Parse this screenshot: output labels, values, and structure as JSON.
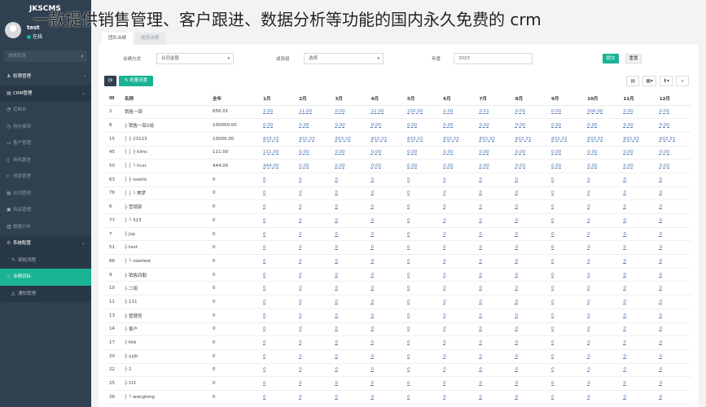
{
  "watermark": "一款提供销售管理、客户跟进、数据分析等功能的国内永久免费的 crm",
  "brand": "JKSCMS",
  "user": {
    "name": "test",
    "status": "在线"
  },
  "sidebar": {
    "search_placeholder": "搜索菜单",
    "items": [
      {
        "label": "权限管理",
        "icon": "users-icon",
        "state": "normal"
      },
      {
        "label": "CRM管理",
        "icon": "grid-icon",
        "state": "open"
      },
      {
        "label": "控制台",
        "icon": "dashboard-icon",
        "state": "dim"
      },
      {
        "label": "待办事项",
        "icon": "clock-icon",
        "state": "dim"
      },
      {
        "label": "客户管理",
        "icon": "folder-icon",
        "state": "dim"
      },
      {
        "label": "商机跟进",
        "icon": "file-icon",
        "state": "dim"
      },
      {
        "label": "线索管理",
        "icon": "search-icon",
        "state": "dim"
      },
      {
        "label": "合同管理",
        "icon": "doc-icon",
        "state": "dim"
      },
      {
        "label": "商品管理",
        "icon": "box-icon",
        "state": "dim"
      },
      {
        "label": "数据分析",
        "icon": "chart-icon",
        "state": "dim"
      },
      {
        "label": "系统配置",
        "icon": "gear-icon",
        "state": "open"
      },
      {
        "label": "审批流程",
        "icon": "flow-icon",
        "state": "sub"
      },
      {
        "label": "业绩目标",
        "icon": "target-icon",
        "state": "active"
      },
      {
        "label": "通知管理",
        "icon": "bell-icon",
        "state": "sub"
      }
    ]
  },
  "tabs": [
    "团队业绩",
    "成员业绩"
  ],
  "filter": {
    "perf_label": "业绩方式",
    "perf_value": "合同金额",
    "member_label": "成员组",
    "member_value": "选择",
    "year_label": "年度",
    "year_value": "2023",
    "submit": "提交",
    "reset": "重置"
  },
  "toolbar": {
    "refresh": "⟳",
    "batch": "✎ 批量设置",
    "btn1": "▤",
    "btn2": "▦▾",
    "btn3": "⬇▾",
    "btn4": "⌕"
  },
  "table": {
    "headers": [
      "ID",
      "名称",
      "全年",
      "1月",
      "2月",
      "3月",
      "4月",
      "5月",
      "6月",
      "7月",
      "8月",
      "9月",
      "10月",
      "11月",
      "12月"
    ],
    "rows": [
      [
        "2",
        "销售一部",
        "656.01",
        "2.00",
        "11.00",
        "0.00",
        "22.00",
        "100.00",
        "0.00",
        "0.01",
        "0.00",
        "0.00",
        "506.00",
        "0.00",
        "0.00"
      ],
      [
        "8",
        "├ 销售一部2组",
        "100000.00",
        "0.00",
        "0.00",
        "0.00",
        "0.00",
        "0.00",
        "0.00",
        "0.00",
        "0.00",
        "0.00",
        "0.00",
        "0.00",
        "0.00"
      ],
      [
        "15",
        "│ ├ 23123",
        "10000.00",
        "833.33",
        "833.33",
        "833.33",
        "833.33",
        "833.33",
        "833.33",
        "833.33",
        "833.33",
        "833.33",
        "833.33",
        "833.33",
        "833.33"
      ],
      [
        "45",
        "│ │ ├ kimc",
        "111.00",
        "111.00",
        "0.00",
        "0.00",
        "0.00",
        "0.00",
        "0.00",
        "0.00",
        "0.00",
        "0.00",
        "0.00",
        "0.00",
        "0.00"
      ],
      [
        "50",
        "│ │ └ hcsi",
        "444.00",
        "444.00",
        "0.00",
        "0.00",
        "0.00",
        "0.00",
        "0.00",
        "0.00",
        "0.00",
        "0.00",
        "0.00",
        "0.00",
        "0.00"
      ],
      [
        "63",
        "│ ├ sswho",
        "0",
        "0",
        "0",
        "0",
        "0",
        "0",
        "0",
        "0",
        "0",
        "0",
        "0",
        "0",
        "0"
      ],
      [
        "76",
        "│ │ └ 美梦",
        "0",
        "0",
        "0",
        "0",
        "0",
        "0",
        "0",
        "0",
        "0",
        "0",
        "0",
        "0",
        "0"
      ],
      [
        "6",
        "├ 营销部",
        "0",
        "0",
        "0",
        "0",
        "0",
        "0",
        "0",
        "0",
        "0",
        "0",
        "0",
        "0",
        "0"
      ],
      [
        "77",
        "│ └ 323",
        "0",
        "0",
        "0",
        "0",
        "0",
        "0",
        "0",
        "0",
        "0",
        "0",
        "0",
        "0",
        "0"
      ],
      [
        "7",
        "├ jsp",
        "0",
        "0",
        "0",
        "0",
        "0",
        "0",
        "0",
        "0",
        "0",
        "0",
        "0",
        "0",
        "0"
      ],
      [
        "51",
        "├ test",
        "0",
        "0",
        "0",
        "0",
        "0",
        "0",
        "0",
        "0",
        "0",
        "0",
        "0",
        "0",
        "0"
      ],
      [
        "86",
        "│ └ xiaotest",
        "0",
        "0",
        "0",
        "0",
        "0",
        "0",
        "0",
        "0",
        "0",
        "0",
        "0",
        "0",
        "0"
      ],
      [
        "9",
        "├ 销售四勤",
        "0",
        "0",
        "0",
        "0",
        "0",
        "0",
        "0",
        "0",
        "0",
        "0",
        "0",
        "0",
        "0"
      ],
      [
        "10",
        "├ 二组",
        "0",
        "0",
        "0",
        "0",
        "0",
        "0",
        "0",
        "0",
        "0",
        "0",
        "0",
        "0",
        "0"
      ],
      [
        "11",
        "├ 111",
        "0",
        "0",
        "0",
        "0",
        "0",
        "0",
        "0",
        "0",
        "0",
        "0",
        "0",
        "0",
        "0"
      ],
      [
        "13",
        "├ 管理员",
        "0",
        "0",
        "0",
        "0",
        "0",
        "0",
        "0",
        "0",
        "0",
        "0",
        "0",
        "0",
        "0"
      ],
      [
        "14",
        "├ 客户",
        "0",
        "0",
        "0",
        "0",
        "0",
        "0",
        "0",
        "0",
        "0",
        "0",
        "0",
        "0",
        "0"
      ],
      [
        "17",
        "├ kkk",
        "0",
        "0",
        "0",
        "0",
        "0",
        "0",
        "0",
        "0",
        "0",
        "0",
        "0",
        "0",
        "0"
      ],
      [
        "20",
        "├ yyjh",
        "0",
        "0",
        "0",
        "0",
        "0",
        "0",
        "0",
        "0",
        "0",
        "0",
        "0",
        "0",
        "0"
      ],
      [
        "22",
        "├ 1",
        "0",
        "0",
        "0",
        "0",
        "0",
        "0",
        "0",
        "0",
        "0",
        "0",
        "0",
        "0",
        "0"
      ],
      [
        "25",
        "├ 1f2",
        "0",
        "0",
        "0",
        "0",
        "0",
        "0",
        "0",
        "0",
        "0",
        "0",
        "0",
        "0",
        "0"
      ],
      [
        "26",
        "│ └ wanglong",
        "0",
        "0",
        "0",
        "0",
        "0",
        "0",
        "0",
        "0",
        "0",
        "0",
        "0",
        "0",
        "0"
      ]
    ]
  },
  "colors": {
    "sidebar": "#2f4050",
    "accent": "#1ab394",
    "link": "#4e78b5"
  }
}
